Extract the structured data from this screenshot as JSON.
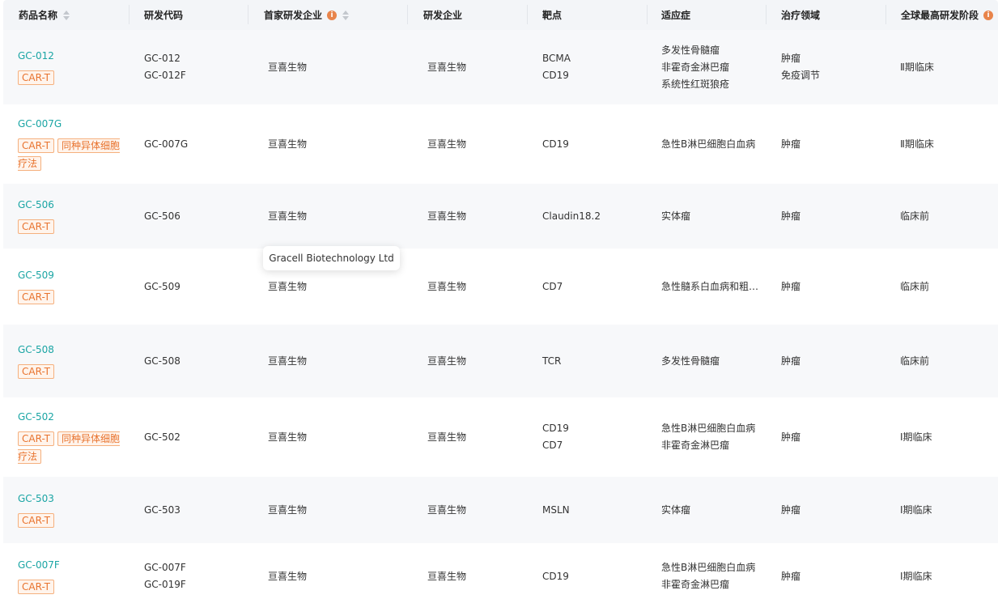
{
  "headers": {
    "drug_name": "药品名称",
    "dev_code": "研发代码",
    "first_company": "首家研发企业",
    "company": "研发企业",
    "target": "靶点",
    "indication": "适应症",
    "therapy_area": "治疗领域",
    "highest_stage": "全球最高研发阶段"
  },
  "tooltip": "Gracell Biotechnology Ltd",
  "rows": [
    {
      "name": "GC-012",
      "tags": [
        "CAR-T"
      ],
      "codes": [
        "GC-012",
        "GC-012F"
      ],
      "first_company": "亘喜生物",
      "company": "亘喜生物",
      "targets": [
        "BCMA",
        "CD19"
      ],
      "indications": [
        "多发性骨髓瘤",
        "非霍奇金淋巴瘤",
        "系统性红斑狼疮"
      ],
      "areas": [
        "肿瘤",
        "免疫调节"
      ],
      "stage": "Ⅱ期临床"
    },
    {
      "name": "GC-007G",
      "tags": [
        "CAR-T",
        "同种异体细胞疗法"
      ],
      "codes": [
        "GC-007G"
      ],
      "first_company": "亘喜生物",
      "company": "亘喜生物",
      "targets": [
        "CD19"
      ],
      "indications": [
        "急性B淋巴细胞白血病"
      ],
      "areas": [
        "肿瘤"
      ],
      "stage": "Ⅱ期临床"
    },
    {
      "name": "GC-506",
      "tags": [
        "CAR-T"
      ],
      "codes": [
        "GC-506"
      ],
      "first_company": "亘喜生物",
      "company": "亘喜生物",
      "targets": [
        "Claudin18.2"
      ],
      "indications": [
        "实体瘤"
      ],
      "areas": [
        "肿瘤"
      ],
      "stage": "临床前"
    },
    {
      "name": "GC-509",
      "tags": [
        "CAR-T"
      ],
      "codes": [
        "GC-509"
      ],
      "first_company": "亘喜生物",
      "company": "亘喜生物",
      "targets": [
        "CD7"
      ],
      "indications": [
        "急性髓系白血病和粗…"
      ],
      "areas": [
        "肿瘤"
      ],
      "stage": "临床前"
    },
    {
      "name": "GC-508",
      "tags": [
        "CAR-T"
      ],
      "codes": [
        "GC-508"
      ],
      "first_company": "亘喜生物",
      "company": "亘喜生物",
      "targets": [
        "TCR"
      ],
      "indications": [
        "多发性骨髓瘤"
      ],
      "areas": [
        "肿瘤"
      ],
      "stage": "临床前"
    },
    {
      "name": "GC-502",
      "tags": [
        "CAR-T",
        "同种异体细胞疗法"
      ],
      "codes": [
        "GC-502"
      ],
      "first_company": "亘喜生物",
      "company": "亘喜生物",
      "targets": [
        "CD19",
        "CD7"
      ],
      "indications": [
        "急性B淋巴细胞白血病",
        "非霍奇金淋巴瘤"
      ],
      "areas": [
        "肿瘤"
      ],
      "stage": "Ⅰ期临床"
    },
    {
      "name": "GC-503",
      "tags": [
        "CAR-T"
      ],
      "codes": [
        "GC-503"
      ],
      "first_company": "亘喜生物",
      "company": "亘喜生物",
      "targets": [
        "MSLN"
      ],
      "indications": [
        "实体瘤"
      ],
      "areas": [
        "肿瘤"
      ],
      "stage": "Ⅰ期临床"
    },
    {
      "name": "GC-007F",
      "tags": [
        "CAR-T"
      ],
      "codes": [
        "GC-007F",
        "GC-019F"
      ],
      "first_company": "亘喜生物",
      "company": "亘喜生物",
      "targets": [
        "CD19"
      ],
      "indications": [
        "急性B淋巴细胞白血病",
        "非霍奇金淋巴瘤"
      ],
      "areas": [
        "肿瘤"
      ],
      "stage": "Ⅰ期临床"
    }
  ]
}
